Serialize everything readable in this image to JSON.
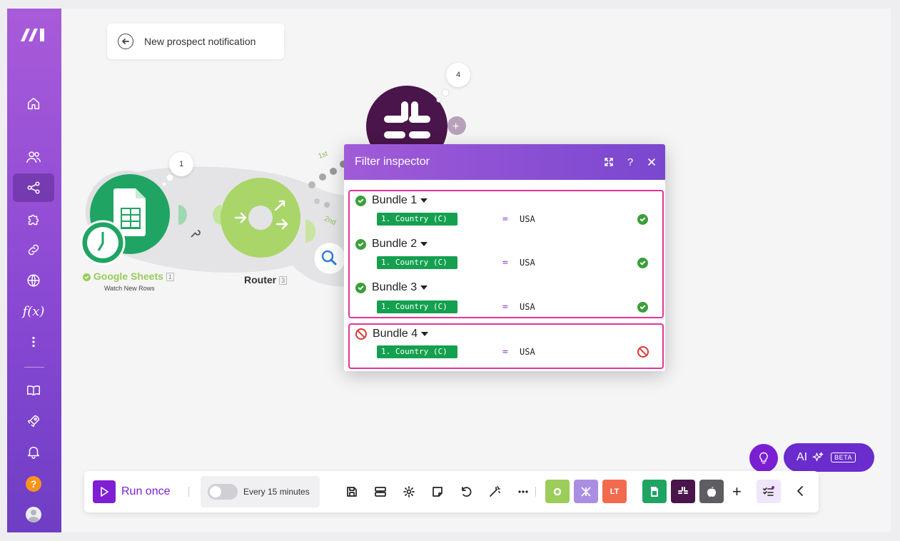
{
  "scenario": {
    "title": "New prospect notification"
  },
  "sidebar": {
    "items": [
      {
        "name": "home"
      },
      {
        "name": "team"
      },
      {
        "name": "scenarios"
      },
      {
        "name": "templates"
      },
      {
        "name": "connections"
      },
      {
        "name": "webhooks"
      },
      {
        "name": "functions",
        "label": "f(x)"
      },
      {
        "name": "more"
      },
      {
        "name": "docs"
      },
      {
        "name": "whats-new"
      },
      {
        "name": "notifications"
      },
      {
        "name": "help",
        "label": "?"
      },
      {
        "name": "profile"
      }
    ]
  },
  "diagram": {
    "nodes": [
      {
        "label": "Google Sheets",
        "id": "1",
        "sub": "Watch New Rows",
        "bubble": "1"
      },
      {
        "label": "Router",
        "id": "3"
      },
      {
        "label": "",
        "id": "",
        "bubble": "4"
      }
    ],
    "routes": [
      "1st",
      "2nd"
    ]
  },
  "inspector": {
    "title": "Filter inspector",
    "controls": [
      "expand",
      "?",
      "×"
    ],
    "bundles": [
      {
        "name": "Bundle 1",
        "field": "1. Country (C)",
        "op": "=",
        "value": "USA",
        "pass": true
      },
      {
        "name": "Bundle 2",
        "field": "1. Country (C)",
        "op": "=",
        "value": "USA",
        "pass": true
      },
      {
        "name": "Bundle 3",
        "field": "1. Country (C)",
        "op": "=",
        "value": "USA",
        "pass": true
      },
      {
        "name": "Bundle 4",
        "field": "1. Country (C)",
        "op": "=",
        "value": "USA",
        "pass": false
      }
    ]
  },
  "toolbar": {
    "run_label": "Run once",
    "schedule_label": "Every 15 minutes",
    "tools": [
      "save",
      "scheduling",
      "settings",
      "notes",
      "undo",
      "auto-align",
      "more"
    ],
    "app_tiles": [
      {
        "name": "tools",
        "color": "#9ccc5a"
      },
      {
        "name": "flow-control",
        "color": "#a98ee2"
      },
      {
        "name": "text-parser",
        "color": "#f26b4f",
        "label": "LT"
      },
      {
        "name": "google-sheets",
        "color": "#1fa463"
      },
      {
        "name": "slack",
        "color": "#4a154b"
      },
      {
        "name": "apple",
        "color": "#5e5e62"
      }
    ]
  },
  "ai": {
    "label": "AI",
    "badge": "BETA"
  },
  "colors": {
    "brand": "#7e1fd4",
    "match": "#14a04f",
    "highlight": "#e3359a",
    "fail": "#d93a3a"
  }
}
